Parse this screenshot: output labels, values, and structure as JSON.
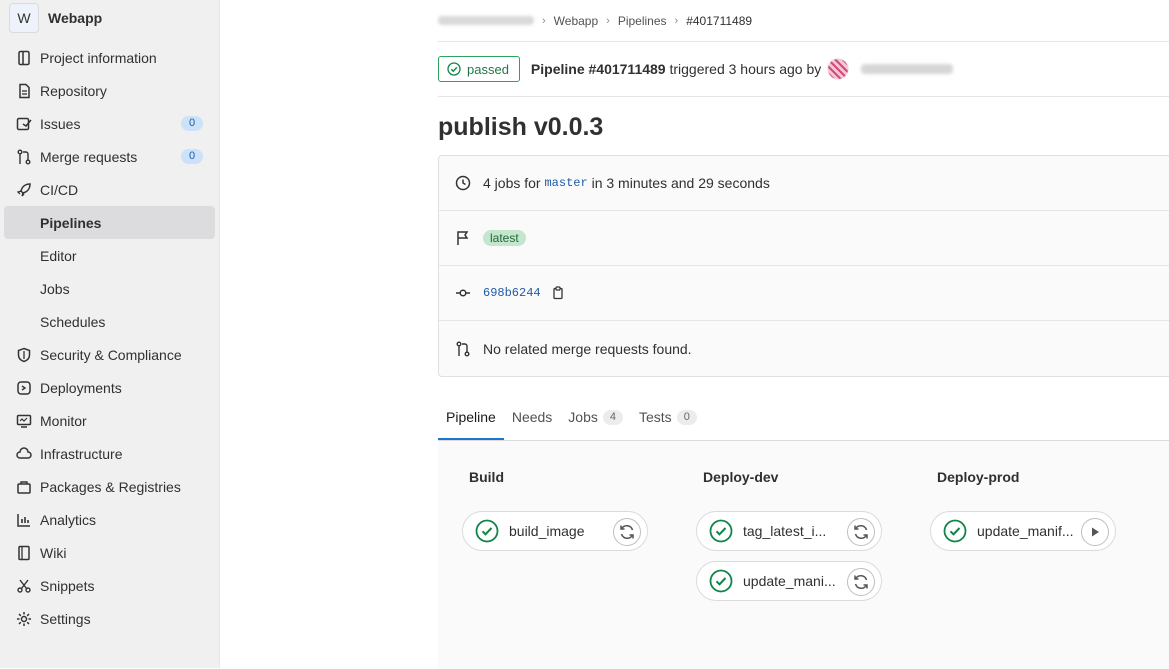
{
  "project": {
    "avatar_letter": "W",
    "name": "Webapp"
  },
  "sidebar": {
    "items": [
      {
        "label": "Project information",
        "icon": "project-info-icon"
      },
      {
        "label": "Repository",
        "icon": "doc-icon"
      },
      {
        "label": "Issues",
        "icon": "issues-icon",
        "count": "0"
      },
      {
        "label": "Merge requests",
        "icon": "merge-request-icon",
        "count": "0"
      },
      {
        "label": "CI/CD",
        "icon": "rocket-icon"
      },
      {
        "label": "Pipelines"
      },
      {
        "label": "Editor"
      },
      {
        "label": "Jobs"
      },
      {
        "label": "Schedules"
      },
      {
        "label": "Security & Compliance",
        "icon": "shield-icon"
      },
      {
        "label": "Deployments",
        "icon": "deploy-icon"
      },
      {
        "label": "Monitor",
        "icon": "monitor-icon"
      },
      {
        "label": "Infrastructure",
        "icon": "cloud-icon"
      },
      {
        "label": "Packages & Registries",
        "icon": "package-icon"
      },
      {
        "label": "Analytics",
        "icon": "chart-icon"
      },
      {
        "label": "Wiki",
        "icon": "book-icon"
      },
      {
        "label": "Snippets",
        "icon": "scissors-icon"
      },
      {
        "label": "Settings",
        "icon": "gear-icon"
      }
    ]
  },
  "breadcrumb": {
    "project": "Webapp",
    "section": "Pipelines",
    "current": "#401711489"
  },
  "header": {
    "status": "passed",
    "pipeline": "Pipeline #401711489",
    "triggered": "triggered 3 hours ago by"
  },
  "title": "publish v0.0.3",
  "info": {
    "jobs_prefix": "4 jobs for",
    "branch": "master",
    "duration": "in 3 minutes and 29 seconds",
    "tag": "latest",
    "commit": "698b6244",
    "mr": "No related merge requests found."
  },
  "tabs": [
    {
      "label": "Pipeline"
    },
    {
      "label": "Needs"
    },
    {
      "label": "Jobs",
      "count": "4"
    },
    {
      "label": "Tests",
      "count": "0"
    }
  ],
  "stages": [
    {
      "name": "Build",
      "jobs": [
        "build_image"
      ]
    },
    {
      "name": "Deploy-dev",
      "jobs": [
        "tag_latest_i...",
        "update_mani..."
      ]
    },
    {
      "name": "Deploy-prod",
      "jobs": [
        "update_manif..."
      ]
    }
  ],
  "colors": {
    "success": "#108548",
    "link": "#1f5ba8",
    "active_tab": "#1f75cb"
  }
}
